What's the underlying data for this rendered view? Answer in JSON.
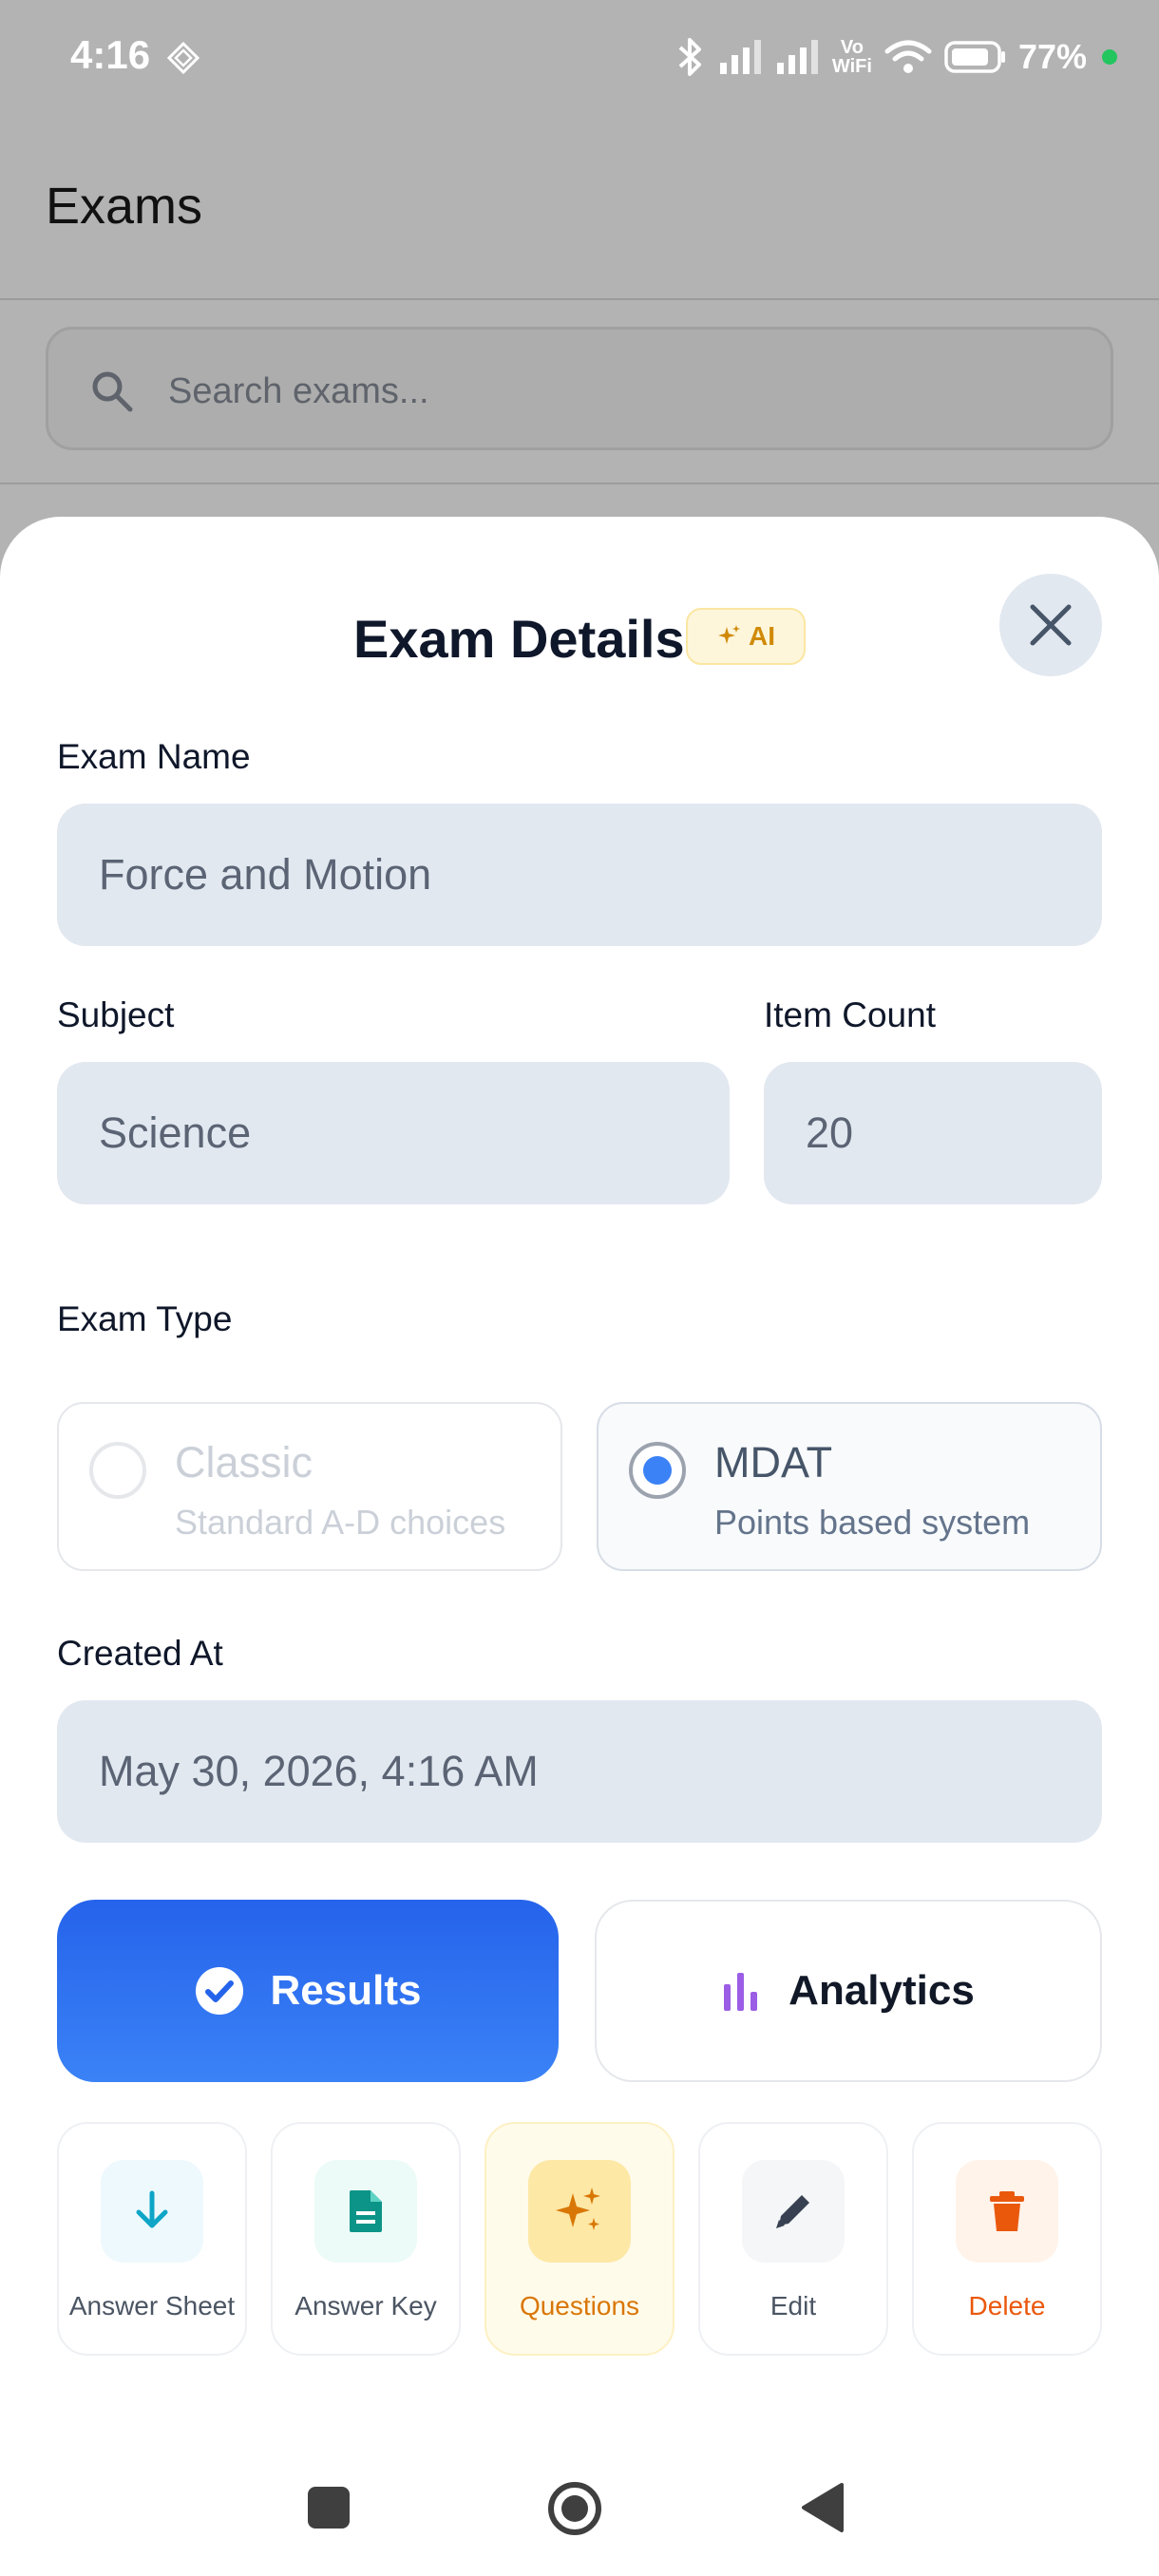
{
  "status_bar": {
    "time": "4:16",
    "vowifi_top": "Vo",
    "vowifi_bottom": "WiFi",
    "battery": "77%"
  },
  "app": {
    "title": "Exams",
    "search_placeholder": "Search exams..."
  },
  "sheet": {
    "title": "Exam Details",
    "ai_badge": "AI",
    "fields": {
      "exam_name_label": "Exam Name",
      "exam_name_value": "Force and Motion",
      "subject_label": "Subject",
      "subject_value": "Science",
      "item_count_label": "Item Count",
      "item_count_value": "20",
      "exam_type_label": "Exam Type",
      "created_at_label": "Created At",
      "created_at_value": "May 30, 2026, 4:16 AM"
    },
    "exam_types": [
      {
        "title": "Classic",
        "subtitle": "Standard A-D choices",
        "selected": false
      },
      {
        "title": "MDAT",
        "subtitle": "Points based system",
        "selected": true
      }
    ],
    "primary_actions": {
      "results": "Results",
      "analytics": "Analytics"
    },
    "tiles": [
      {
        "label": "Answer Sheet",
        "icon": "download-icon",
        "color": "#0ea5c6",
        "bg": "#eef9fd"
      },
      {
        "label": "Answer Key",
        "icon": "document-icon",
        "color": "#0d9488",
        "bg": "#ecfbf7"
      },
      {
        "label": "Questions",
        "icon": "sparkles-icon",
        "color": "#d97706",
        "bg": "#fde8a6"
      },
      {
        "label": "Edit",
        "icon": "pencil-icon",
        "color": "#374151",
        "bg": "#f4f6f8"
      },
      {
        "label": "Delete",
        "icon": "trash-icon",
        "color": "#ea580c",
        "bg": "#fff3ea"
      }
    ]
  },
  "colors": {
    "primary": "#2563eb",
    "accent": "#d97706",
    "analytics_icon": "#9b5de5",
    "delete": "#ea580c"
  }
}
